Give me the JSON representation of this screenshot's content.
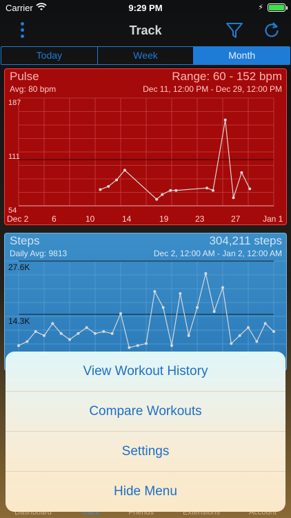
{
  "status": {
    "carrier": "Carrier",
    "time": "9:29 PM",
    "battery_fraction": 1.0
  },
  "nav": {
    "title": "Track"
  },
  "segments": [
    "Today",
    "Week",
    "Month"
  ],
  "active_segment": "Month",
  "pulse": {
    "title": "Pulse",
    "avg": "Avg: 80 bpm",
    "range": "Range: 60 - 152 bpm",
    "dates": "Dec 11, 12:00 PM - Dec 29, 12:00 PM",
    "yticks": [
      "187",
      "111",
      "54"
    ],
    "xticks": [
      "Dec 2",
      "6",
      "10",
      "14",
      "19",
      "23",
      "27",
      "Jan 1"
    ]
  },
  "steps": {
    "title": "Steps",
    "avg": "Daily Avg: 9813",
    "total": "304,211 steps",
    "dates": "Dec 2, 12:00 AM - Jan 2, 12:00 AM",
    "yticks": [
      "27.6K",
      "14.3K"
    ]
  },
  "chart_data": [
    {
      "type": "line",
      "title": "Pulse",
      "x": [
        "Dec 11",
        "Dec 12",
        "Dec 13",
        "Dec 14",
        "Dec 18",
        "Dec 19",
        "Dec 20",
        "Dec 21",
        "Dec 25",
        "Dec 26",
        "Dec 27",
        "Dec 28",
        "Dec 29"
      ],
      "values": [
        74,
        78,
        86,
        98,
        62,
        68,
        73,
        73,
        76,
        73,
        160,
        64,
        95,
        75
      ],
      "ylim": [
        54,
        187
      ],
      "color": "#d8d8d8"
    },
    {
      "type": "line",
      "title": "Steps",
      "values": [
        6500,
        7500,
        10000,
        9000,
        12000,
        9500,
        8000,
        9500,
        11000,
        9500,
        10000,
        9500,
        14500,
        6000,
        6500,
        7000,
        20000,
        16000,
        6500,
        19500,
        9000,
        16000,
        24500,
        15000,
        21000,
        7000,
        9000,
        11000,
        7500,
        12000,
        10000
      ],
      "ylim": [
        0,
        27600
      ],
      "color": "#d8d8d8"
    }
  ],
  "sheet": {
    "view_history": "View Workout History",
    "compare": "Compare Workouts",
    "settings": "Settings",
    "hide": "Hide Menu"
  },
  "tabbar": [
    "Dashboard",
    "Track",
    "Friends",
    "Extensions",
    "Account"
  ]
}
